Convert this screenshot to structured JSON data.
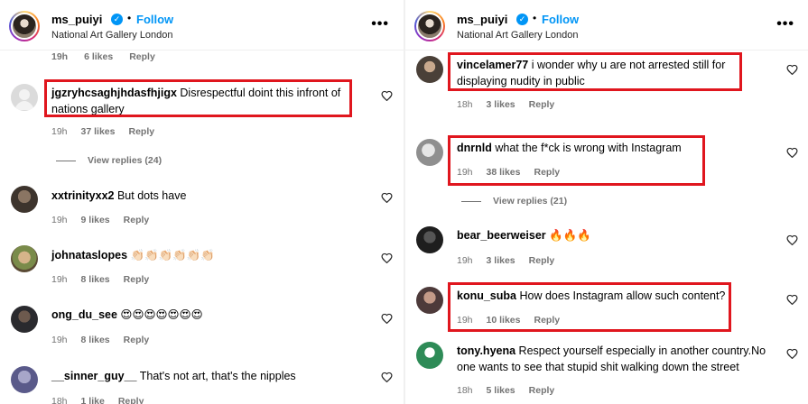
{
  "header": {
    "username": "ms_puiyi",
    "verified_icon": "check",
    "separator": "•",
    "follow_label": "Follow",
    "location": "National Art Gallery London",
    "more_label": "•••"
  },
  "left": {
    "partial_meta": {
      "time": "19h",
      "likes": "6 likes",
      "reply": "Reply"
    },
    "comments": [
      {
        "username": "jgzryhcsaghjhdasfhjigx",
        "text": "Disrespectful doint this infront of nations gallery",
        "time": "19h",
        "likes": "37 likes",
        "reply": "Reply"
      },
      {
        "username": "xxtrinityxx2",
        "text": "But dots have",
        "time": "19h",
        "likes": "9 likes",
        "reply": "Reply"
      },
      {
        "username": "johnataslopes",
        "text": "👏🏻👏🏻👏🏻👏🏻👏🏻👏🏻",
        "time": "19h",
        "likes": "8 likes",
        "reply": "Reply"
      },
      {
        "username": "ong_du_see",
        "text": "😍😍😍😍😍😍😍",
        "time": "19h",
        "likes": "8 likes",
        "reply": "Reply"
      },
      {
        "username": "__sinner_guy__",
        "text": "That's not art, that's the nipples",
        "time": "18h",
        "likes": "1 like",
        "reply": "Reply"
      }
    ],
    "view_replies": "View replies (24)"
  },
  "right": {
    "comments": [
      {
        "username": "vincelamer77",
        "text": "i wonder why u are not arrested still for displaying nudity in public",
        "time": "18h",
        "likes": "3 likes",
        "reply": "Reply"
      },
      {
        "username": "dnrnld",
        "text": "what the f*ck is wrong with Instagram",
        "time": "19h",
        "likes": "38 likes",
        "reply": "Reply"
      },
      {
        "username": "bear_beerweiser",
        "text": "🔥🔥🔥",
        "time": "19h",
        "likes": "3 likes",
        "reply": "Reply"
      },
      {
        "username": "konu_suba",
        "text": "How does Instagram allow such content?",
        "time": "19h",
        "likes": "10 likes",
        "reply": "Reply"
      },
      {
        "username": "tony.hyena",
        "text": "Respect yourself especially in another country.No one wants to see that stupid shit walking down the street",
        "time": "18h",
        "likes": "5 likes",
        "reply": "Reply"
      }
    ],
    "view_replies": "View replies (21)"
  },
  "colors": {
    "accent": "#0095f6",
    "highlight_box": "#e0161e",
    "muted_text": "#737373"
  },
  "icons": [
    "verified-badge-icon",
    "more-options-icon",
    "heart-icon",
    "avatar-icon"
  ]
}
